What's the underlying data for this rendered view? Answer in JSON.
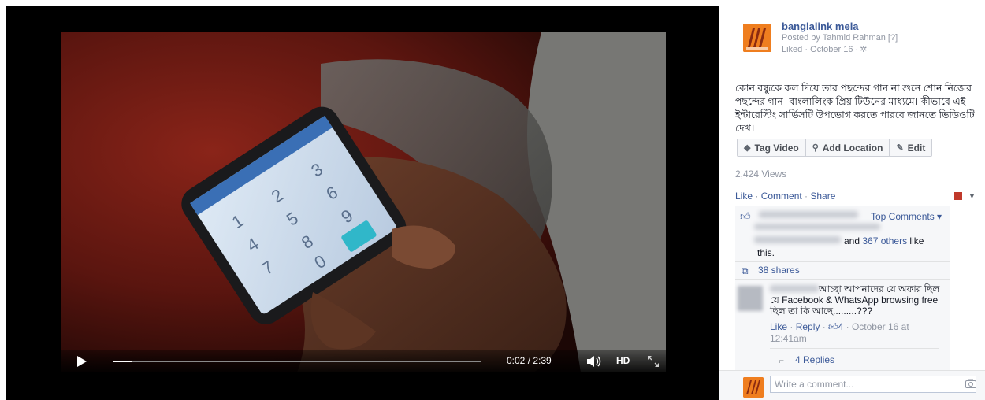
{
  "video": {
    "time_display": "0:02 / 2:39",
    "progress_fraction": 0.007,
    "hd_label": "HD"
  },
  "post": {
    "page_name": "banglalink mela",
    "posted_by": "Posted by Tahmid Rahman [?]",
    "liked_line": "Liked · October 16 ·",
    "description": "কোন বন্ধুকে কল দিয়ে তার পছন্দের গান না শুনে শোন নিজের পছন্দের গান- বাংলালিংক প্রিয় টিউনের মাধ্যমে। কীভাবে এই ইন্টারেস্টিং সার্ভিসটি উপভোগ করতে পারবে জানতে ভিডিওটি দেখ।",
    "actions": {
      "tag_video": "Tag Video",
      "add_location": "Add Location",
      "edit": "Edit"
    },
    "views": "2,424 Views",
    "ufi": {
      "like": "Like",
      "comment": "Comment",
      "share": "Share",
      "sep": " · "
    },
    "likes": {
      "top_comments": "Top Comments ▾",
      "and": "and ",
      "others_link": "367 others",
      "like_suffix": " like",
      "this": "this."
    },
    "shares": "38 shares",
    "comment": {
      "text": "আচ্ছা আপনাদের যে অফার ছিল যে Facebook & WhatsApp browsing free ছিল তা কি আছে.........???",
      "meta_like": "Like",
      "meta_reply": "Reply",
      "meta_likes_count": "4",
      "meta_date": "October 16 at 12:41am"
    },
    "replies": "4 Replies",
    "composer": {
      "placeholder": "Write a comment..."
    }
  },
  "colors": {
    "link": "#3b5998",
    "muted": "#9197a3",
    "brand_orange": "#ef7e1f"
  }
}
